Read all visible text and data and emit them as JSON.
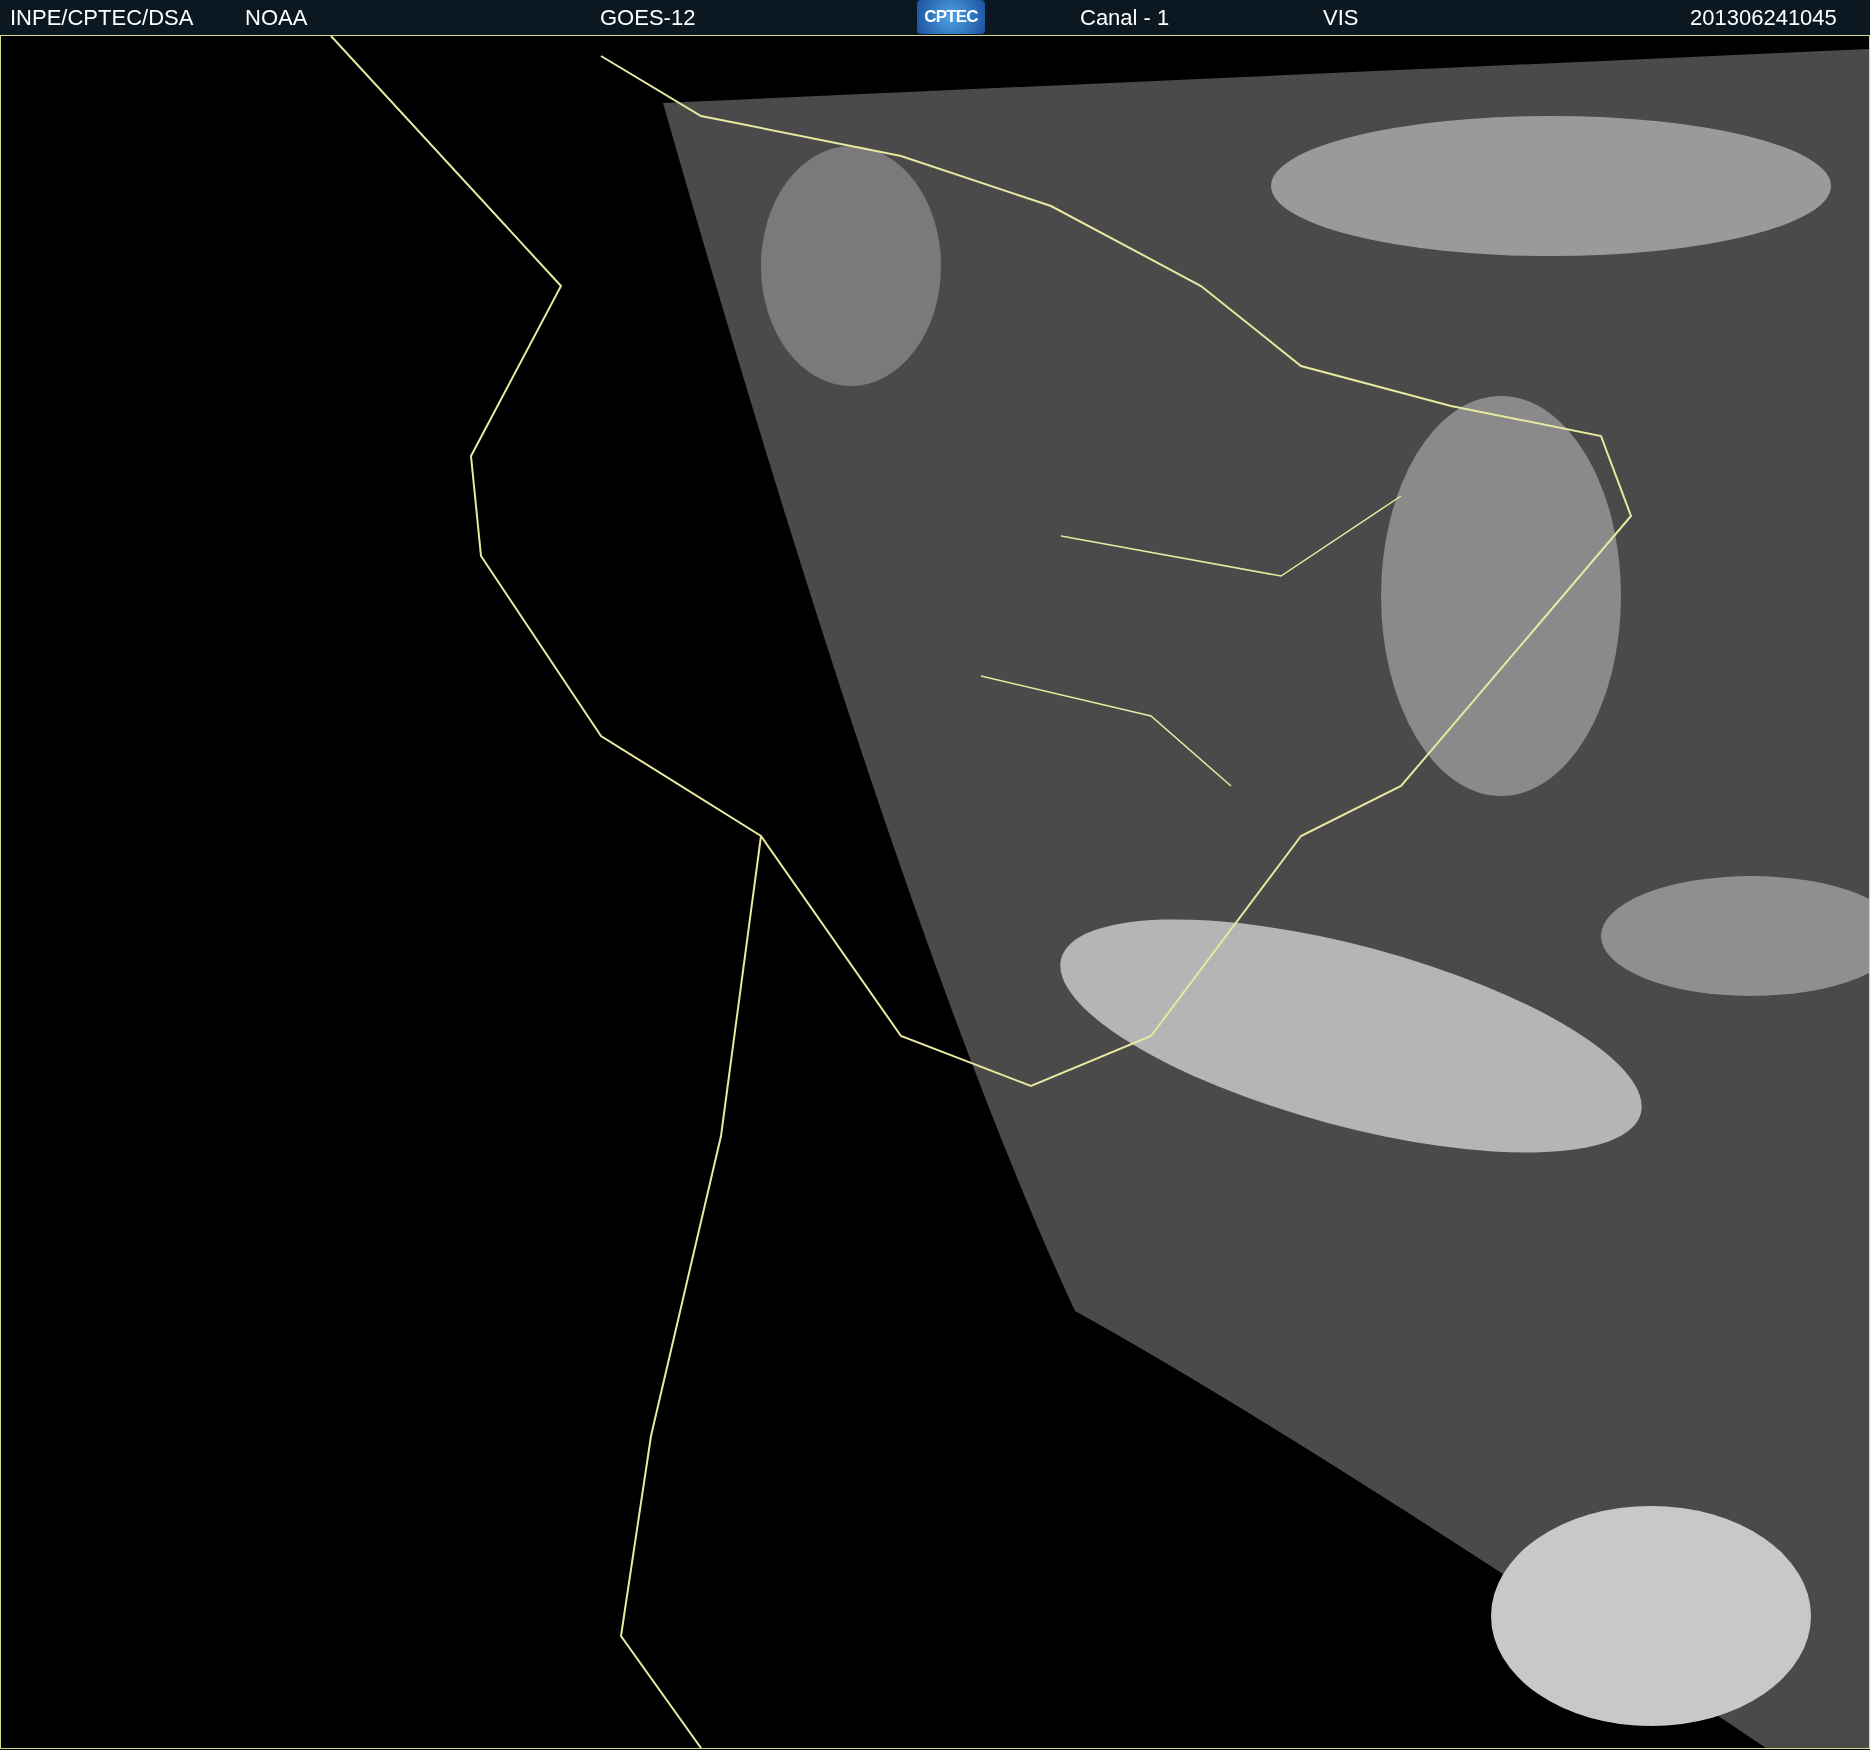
{
  "header": {
    "items": [
      {
        "kind": "text",
        "text": "INPE/CPTEC/DSA"
      },
      {
        "kind": "text",
        "text": "NOAA"
      },
      {
        "kind": "text",
        "text": "GOES-12"
      },
      {
        "kind": "logo",
        "text": "CPTEC"
      },
      {
        "kind": "text",
        "text": "Canal - 1"
      },
      {
        "kind": "text",
        "text": "VIS"
      },
      {
        "kind": "text",
        "text": "201306241045"
      }
    ]
  }
}
